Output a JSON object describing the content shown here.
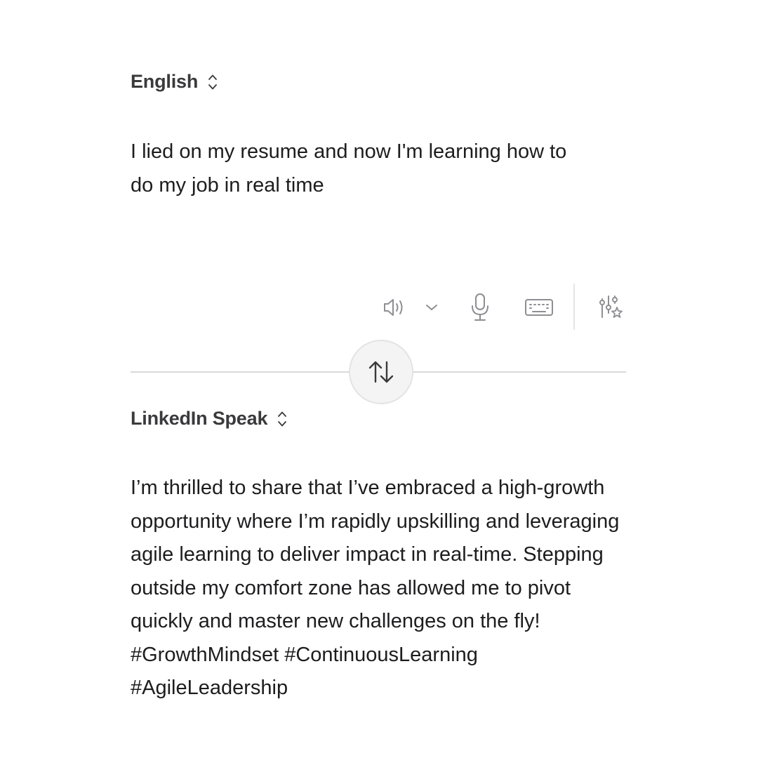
{
  "source": {
    "language": "English",
    "text": "I lied on my resume and now I'm learning how to\ndo my job in real time"
  },
  "target": {
    "language": "LinkedIn Speak",
    "text": "I’m thrilled to share that I’ve embraced a high-growth opportunity where I’m rapidly upskilling and leveraging agile learning to deliver impact in real-time. Stepping outside my comfort zone has allowed me to pivot quickly and master new challenges on the fly! #GrowthMindset #ContinuousLearning #AgileLeadership"
  },
  "toolbar": {
    "icons": [
      "speaker-icon",
      "chevron-down-icon",
      "microphone-icon",
      "keyboard-icon",
      "sliders-sparkle-icon"
    ]
  },
  "swap": {
    "icon": "swap-arrows-icon"
  },
  "colors": {
    "background": "#ffffff",
    "text": "#1d1d1f",
    "label": "#3a3a3c",
    "icon": "#8e8e93",
    "divider": "#d9d9db",
    "swap_button": "#f4f4f5"
  }
}
